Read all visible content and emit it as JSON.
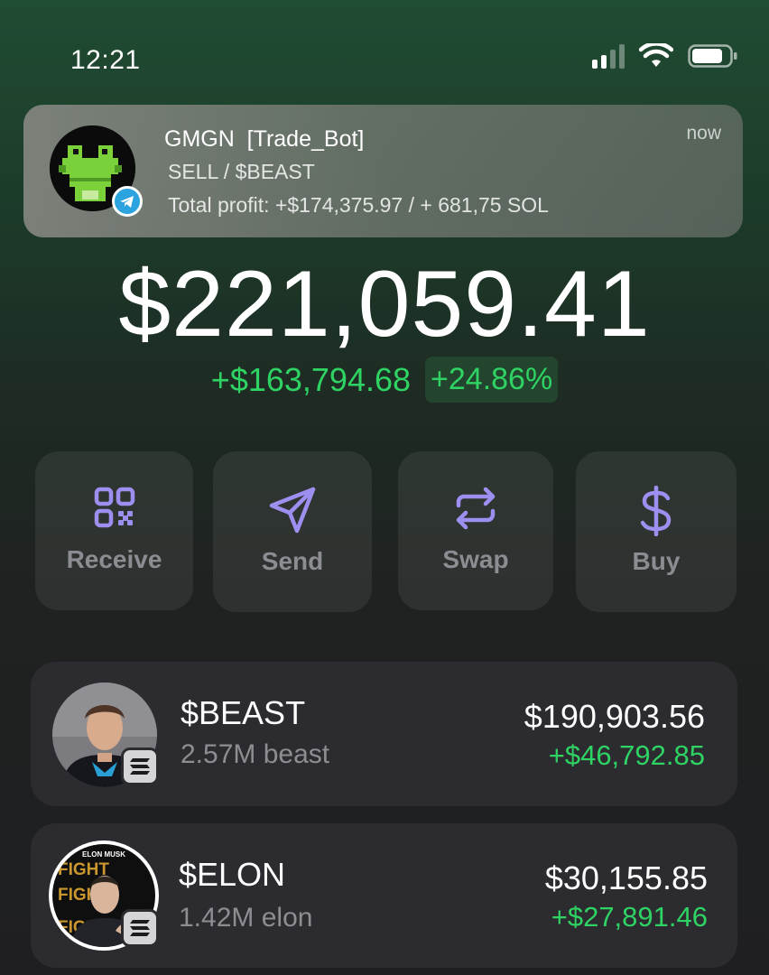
{
  "status_bar": {
    "time": "12:21",
    "icons": [
      "cellular-signal-icon",
      "wifi-icon",
      "battery-icon"
    ]
  },
  "notification": {
    "app_name": "GMGN  [Trade_Bot]",
    "line1": "SELL / $BEAST",
    "line2": "Total profit: +$174,375.97 / + 681,75 SOL",
    "time": "now",
    "icons": [
      "pixel-frog-avatar",
      "telegram-icon"
    ]
  },
  "portfolio": {
    "balance": "$221,059.41",
    "change_amount": "+$163,794.68",
    "change_percent": "+24.86%"
  },
  "actions": [
    {
      "label": "Receive",
      "icon": "qr-code-icon"
    },
    {
      "label": "Send",
      "icon": "send-icon"
    },
    {
      "label": "Swap",
      "icon": "swap-icon"
    },
    {
      "label": "Buy",
      "icon": "dollar-icon"
    }
  ],
  "tokens": [
    {
      "symbol": "$BEAST",
      "amount": "2.57M beast",
      "value": "$190,903.56",
      "change": "+$46,792.85",
      "chain_icon": "solana-icon"
    },
    {
      "symbol": "$ELON",
      "amount": "1.42M elon",
      "value": "$30,155.85",
      "change": "+$27,891.46",
      "chain_icon": "solana-icon",
      "avatar_text_top": "ELON MUSK",
      "avatar_text_poster": "FIGHT"
    }
  ],
  "colors": {
    "positive": "#2fd363",
    "accent_purple": "#9c8ff0",
    "card": "#2b2b30",
    "telegram": "#2aa3df"
  }
}
